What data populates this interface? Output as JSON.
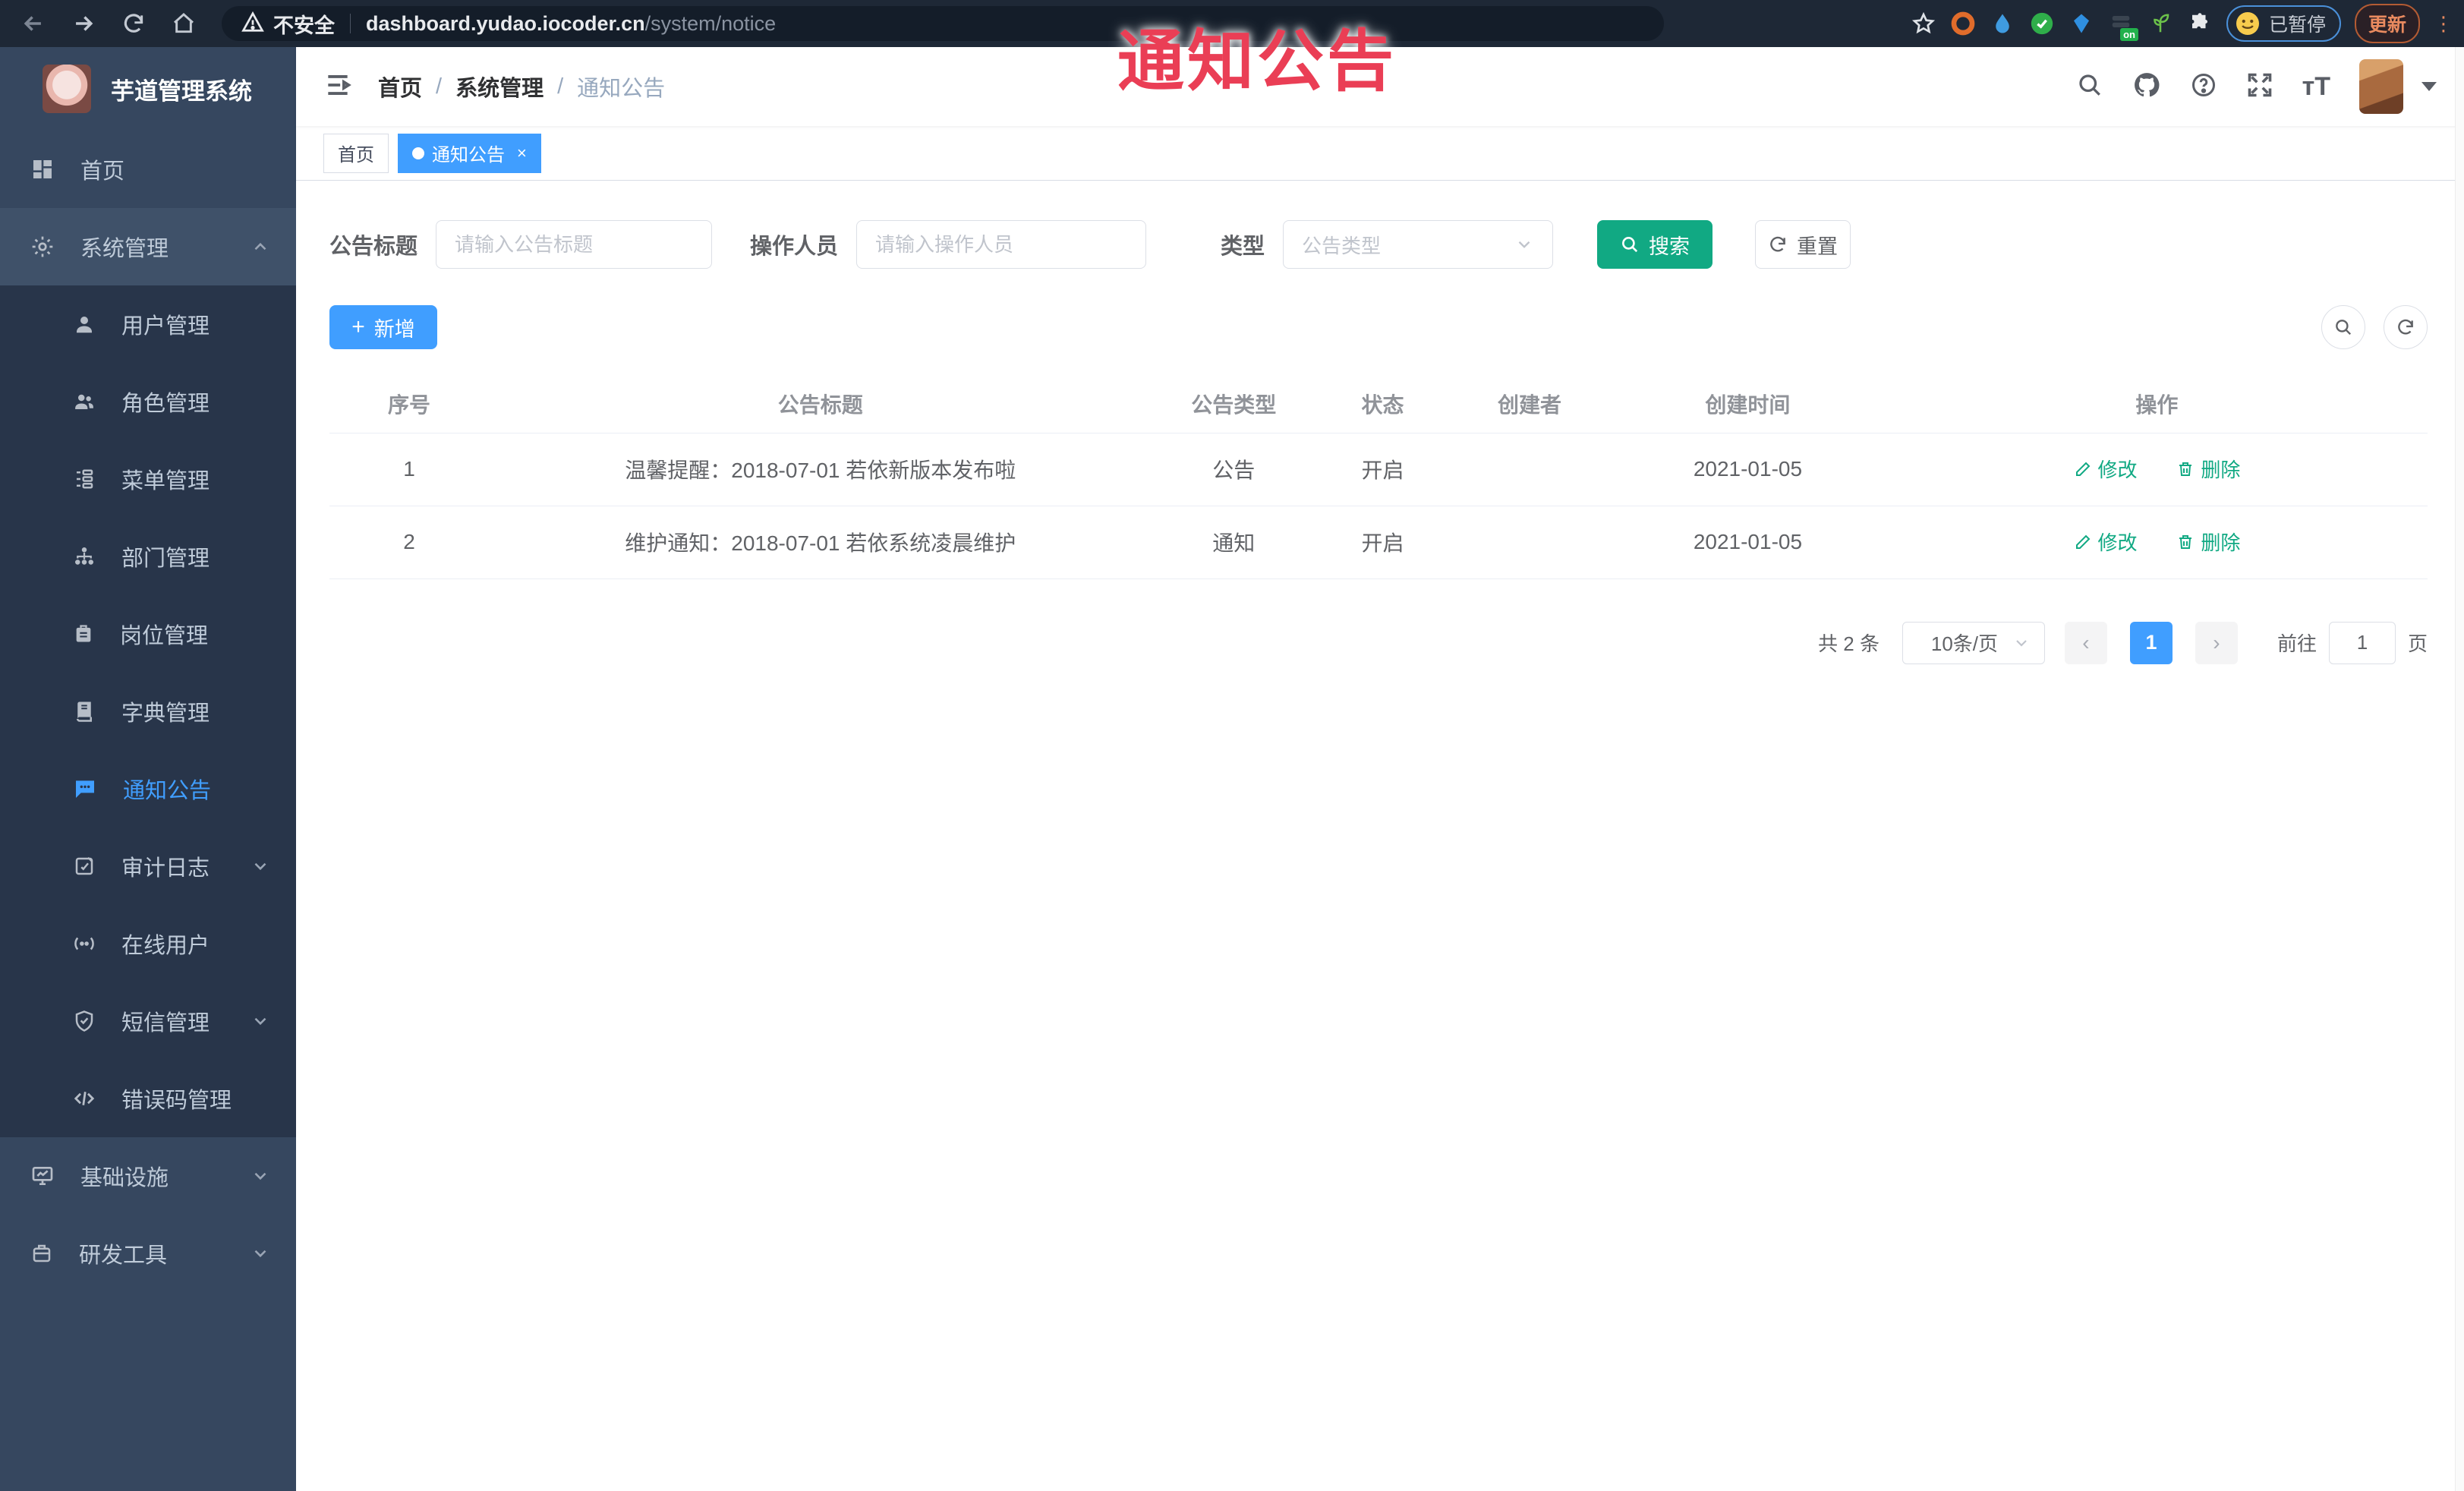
{
  "overlay_title": "通知公告",
  "browser": {
    "security_label": "不安全",
    "url_domain": "dashboard.yudao.iocoder.cn",
    "url_path": "/system/notice",
    "extension_badge": "on",
    "paused_label": "已暂停",
    "update_label": "更新"
  },
  "sidebar": {
    "app_title": "芋道管理系统",
    "items": [
      {
        "label": "首页",
        "icon": "dashboard-icon",
        "level": "top"
      },
      {
        "label": "系统管理",
        "icon": "gear-icon",
        "level": "top",
        "expanded": true
      },
      {
        "label": "用户管理",
        "icon": "user-icon",
        "level": "sub"
      },
      {
        "label": "角色管理",
        "icon": "users-icon",
        "level": "sub"
      },
      {
        "label": "菜单管理",
        "icon": "menu-tree-icon",
        "level": "sub"
      },
      {
        "label": "部门管理",
        "icon": "org-tree-icon",
        "level": "sub"
      },
      {
        "label": "岗位管理",
        "icon": "badge-icon",
        "level": "sub"
      },
      {
        "label": "字典管理",
        "icon": "dict-icon",
        "level": "sub"
      },
      {
        "label": "通知公告",
        "icon": "message-icon",
        "level": "sub",
        "active": true
      },
      {
        "label": "审计日志",
        "icon": "log-icon",
        "level": "sub",
        "collapsible": true
      },
      {
        "label": "在线用户",
        "icon": "online-icon",
        "level": "sub"
      },
      {
        "label": "短信管理",
        "icon": "shield-icon",
        "level": "sub",
        "collapsible": true
      },
      {
        "label": "错误码管理",
        "icon": "code-icon",
        "level": "sub"
      },
      {
        "label": "基础设施",
        "icon": "monitor-icon",
        "level": "top",
        "collapsible": true
      },
      {
        "label": "研发工具",
        "icon": "tool-icon",
        "level": "top",
        "collapsible": true
      }
    ]
  },
  "header": {
    "breadcrumb": {
      "0": "首页",
      "1": "系统管理",
      "2": "通知公告"
    },
    "separator": "/"
  },
  "tabs": [
    {
      "label": "首页",
      "active": false
    },
    {
      "label": "通知公告",
      "active": true,
      "close": "×"
    }
  ],
  "filters": {
    "title_label": "公告标题",
    "title_placeholder": "请输入公告标题",
    "operator_label": "操作人员",
    "operator_placeholder": "请输入操作人员",
    "type_label": "类型",
    "type_placeholder": "公告类型",
    "search_label": "搜索",
    "reset_label": "重置"
  },
  "toolbar": {
    "add_label": "新增"
  },
  "table": {
    "columns": [
      "序号",
      "公告标题",
      "公告类型",
      "状态",
      "创建者",
      "创建时间",
      "操作"
    ],
    "rows": [
      {
        "no": "1",
        "title": "温馨提醒：2018-07-01 若依新版本发布啦",
        "type": "公告",
        "status": "开启",
        "creator": "",
        "created": "2021-01-05"
      },
      {
        "no": "2",
        "title": "维护通知：2018-07-01 若依系统凌晨维护",
        "type": "通知",
        "status": "开启",
        "creator": "",
        "created": "2021-01-05"
      }
    ],
    "edit_label": "修改",
    "delete_label": "删除"
  },
  "pagination": {
    "total_label": "共 2 条",
    "page_size_label": "10条/页",
    "prev_label": "‹",
    "current_page": "1",
    "next_label": "›",
    "goto_label": "前往",
    "goto_value": "1",
    "page_suffix": "页"
  },
  "colors": {
    "accent_blue": "#409eff",
    "accent_teal": "#11a983",
    "overlay_red": "#ea3e55",
    "sidebar_bg": "#36475f",
    "sidebar_sub_bg": "#28354a",
    "chrome_bg": "#1e2836"
  }
}
